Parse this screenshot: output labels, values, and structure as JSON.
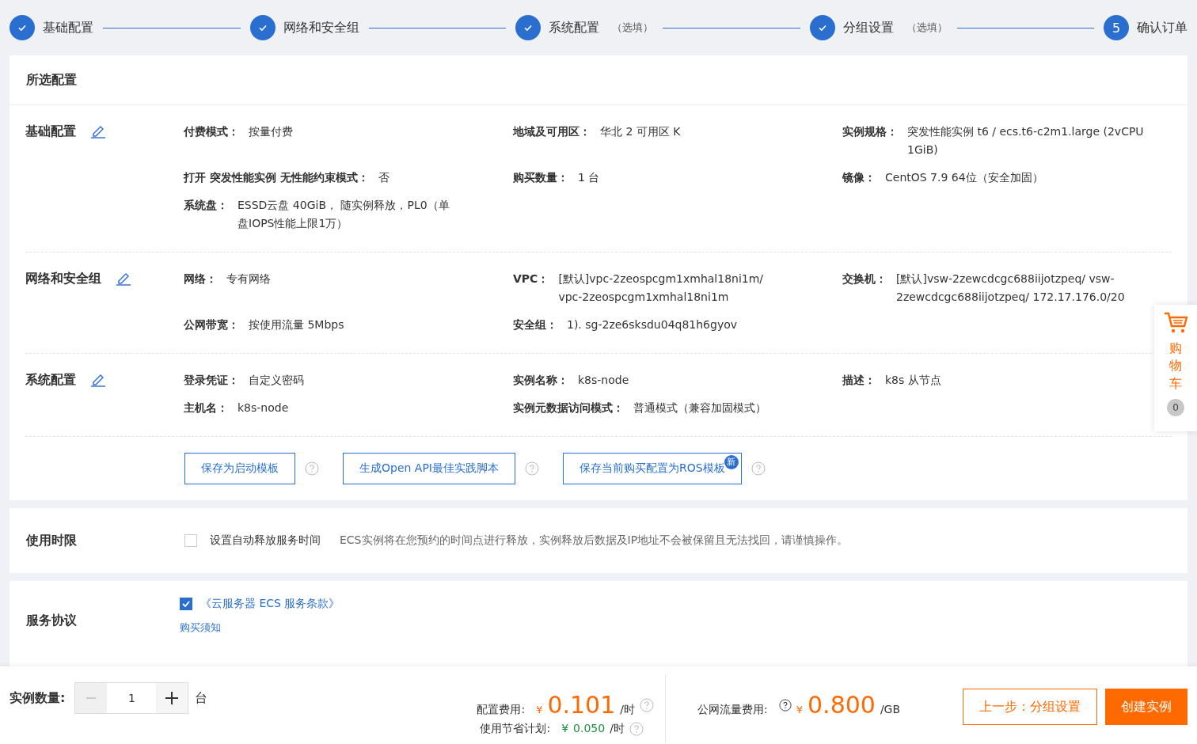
{
  "steps": [
    {
      "label": "基础配置",
      "done": true
    },
    {
      "label": "网络和安全组",
      "done": true
    },
    {
      "label": "系统配置",
      "optional": "（选填）",
      "done": true
    },
    {
      "label": "分组设置",
      "optional": "（选填）",
      "done": true
    },
    {
      "label": "确认订单",
      "done": false,
      "number": "5"
    }
  ],
  "summary": {
    "title": "所选配置",
    "groups": [
      {
        "title": "基础配置",
        "fields": [
          {
            "label": "付费模式：",
            "value": "按量付费"
          },
          {
            "label": "地域及可用区：",
            "value": "华北 2 可用区 K"
          },
          {
            "label": "实例规格：",
            "value": "突发性能实例 t6 / ecs.t6-c2m1.large (2vCPU 1GiB)"
          },
          {
            "label": "打开 突发性能实例 无性能约束模式：",
            "value": "否"
          },
          {
            "label": "购买数量：",
            "value": "1 台"
          },
          {
            "label": "镜像：",
            "value": "CentOS 7.9 64位（安全加固）"
          },
          {
            "label": "系统盘：",
            "value": "ESSD云盘 40GiB， 随实例释放，PL0（单盘IOPS性能上限1万）"
          }
        ]
      },
      {
        "title": "网络和安全组",
        "fields": [
          {
            "label": "网络：",
            "value": "专有网络"
          },
          {
            "label": "VPC：",
            "value": "[默认]vpc-2zeospcgm1xmhal18ni1m/ vpc-2zeospcgm1xmhal18ni1m"
          },
          {
            "label": "交换机：",
            "value": "[默认]vsw-2zewcdcgc688iijotzpeq/ vsw-2zewcdcgc688iijotzpeq/ 172.17.176.0/20"
          },
          {
            "label": "公网带宽：",
            "value": "按使用流量 5Mbps"
          },
          {
            "label": "安全组：",
            "value": "1). sg-2ze6sksdu04q81h6gyov"
          }
        ]
      },
      {
        "title": "系统配置",
        "fields": [
          {
            "label": "登录凭证：",
            "value": "自定义密码"
          },
          {
            "label": "实例名称：",
            "value": "k8s-node"
          },
          {
            "label": "描述：",
            "value": "k8s 从节点"
          },
          {
            "label": "主机名：",
            "value": "k8s-node"
          },
          {
            "label": "实例元数据访问模式：",
            "value": "普通模式（兼容加固模式）"
          }
        ]
      }
    ],
    "actions": [
      {
        "label": "保存为启动模板"
      },
      {
        "label": "生成Open API最佳实践脚本"
      },
      {
        "label": "保存当前购买配置为ROS模板",
        "badge": "新"
      }
    ]
  },
  "usage_period": {
    "title": "使用时限",
    "option": "设置自动释放服务时间",
    "checked": false,
    "note": "ECS实例将在您预约的时间点进行释放，实例释放后数据及IP地址不会被保留且无法找回，请谨慎操作。"
  },
  "agreement": {
    "title": "服务协议",
    "link": "《云服务器 ECS 服务条款》",
    "checked": true,
    "notice": "购买须知"
  },
  "cart": {
    "label": "购物车",
    "count": "0"
  },
  "footer": {
    "quantity_label": "实例数量:",
    "quantity": "1",
    "unit": "台",
    "config_fee_label": "配置费用:",
    "config_fee_currency": "¥",
    "config_fee": "0.101",
    "config_fee_unit": "/时",
    "savings_label": "使用节省计划:",
    "savings_currency": "¥",
    "savings": "0.050",
    "savings_unit": "/时",
    "traffic_fee_label": "公网流量费用:",
    "traffic_fee_currency": "¥",
    "traffic_fee": "0.800",
    "traffic_fee_unit": "/GB",
    "prev_button": "上一步：分组设置",
    "create_button": "创建实例"
  }
}
